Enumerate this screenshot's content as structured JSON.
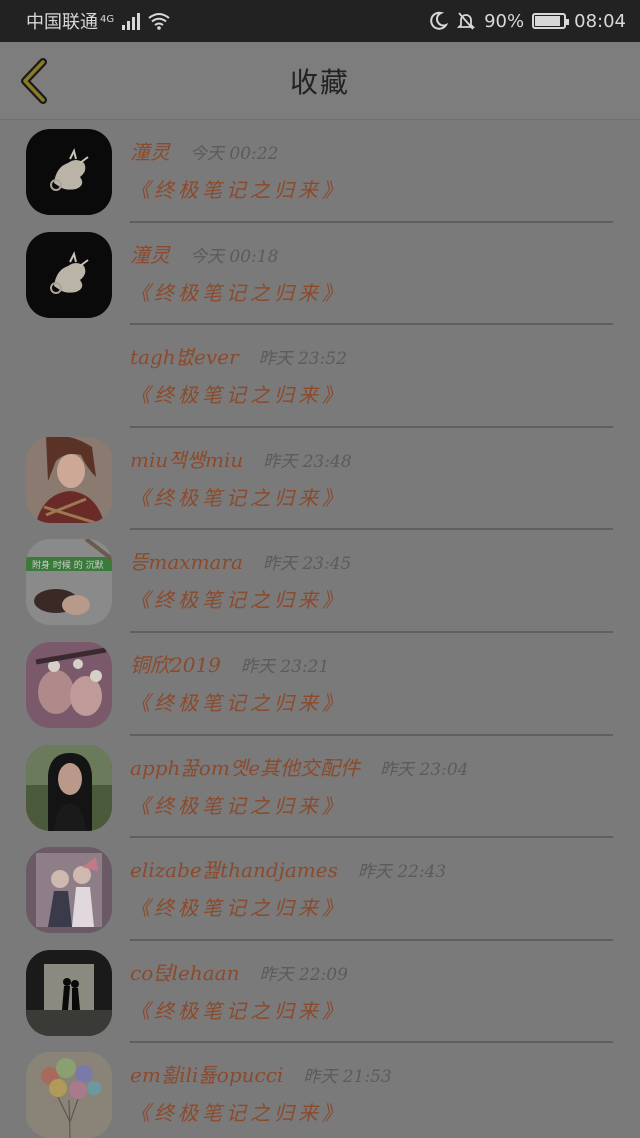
{
  "status_bar": {
    "carrier": "中国联通",
    "network": "4G",
    "battery": "90%",
    "time": "08:04"
  },
  "header": {
    "title": "收藏"
  },
  "favorites": [
    {
      "user": "潼灵",
      "time": "今天 00:22",
      "book": "《终极笔记之归来》",
      "avatar": "dragon"
    },
    {
      "user": "潼灵",
      "time": "今天 00:18",
      "book": "《终极笔记之归来》",
      "avatar": "dragon"
    },
    {
      "user": "tagh볎ever",
      "time": "昨天 23:52",
      "book": "《终极笔记之归来》",
      "avatar": "none"
    },
    {
      "user": "miu잭쌩miu",
      "time": "昨天 23:48",
      "book": "《终极笔记之归来》",
      "avatar": "girl"
    },
    {
      "user": "뜽maxmara",
      "time": "昨天 23:45",
      "book": "《终极笔记之归来》",
      "avatar": "sleep"
    },
    {
      "user": "铜欣2019",
      "time": "昨天 23:21",
      "book": "《终极笔记之归来》",
      "avatar": "filter"
    },
    {
      "user": "apph꿆om옛e其他交配件",
      "time": "昨天 23:04",
      "book": "《终极笔记之归来》",
      "avatar": "longhair"
    },
    {
      "user": "elizabe꿢thandjames",
      "time": "昨天 22:43",
      "book": "《终极笔记之归来》",
      "avatar": "couple"
    },
    {
      "user": "co턵lehaan",
      "time": "昨天 22:09",
      "book": "《终极笔记之归来》",
      "avatar": "tunnel"
    },
    {
      "user": "em횖ili툞opucci",
      "time": "昨天 21:53",
      "book": "《终极笔记之归来》",
      "avatar": "balloons"
    }
  ],
  "colors": {
    "overlay_bg": "#7a7a7a",
    "accent_text": "#8c4a2c",
    "status_bar": "#222222"
  }
}
